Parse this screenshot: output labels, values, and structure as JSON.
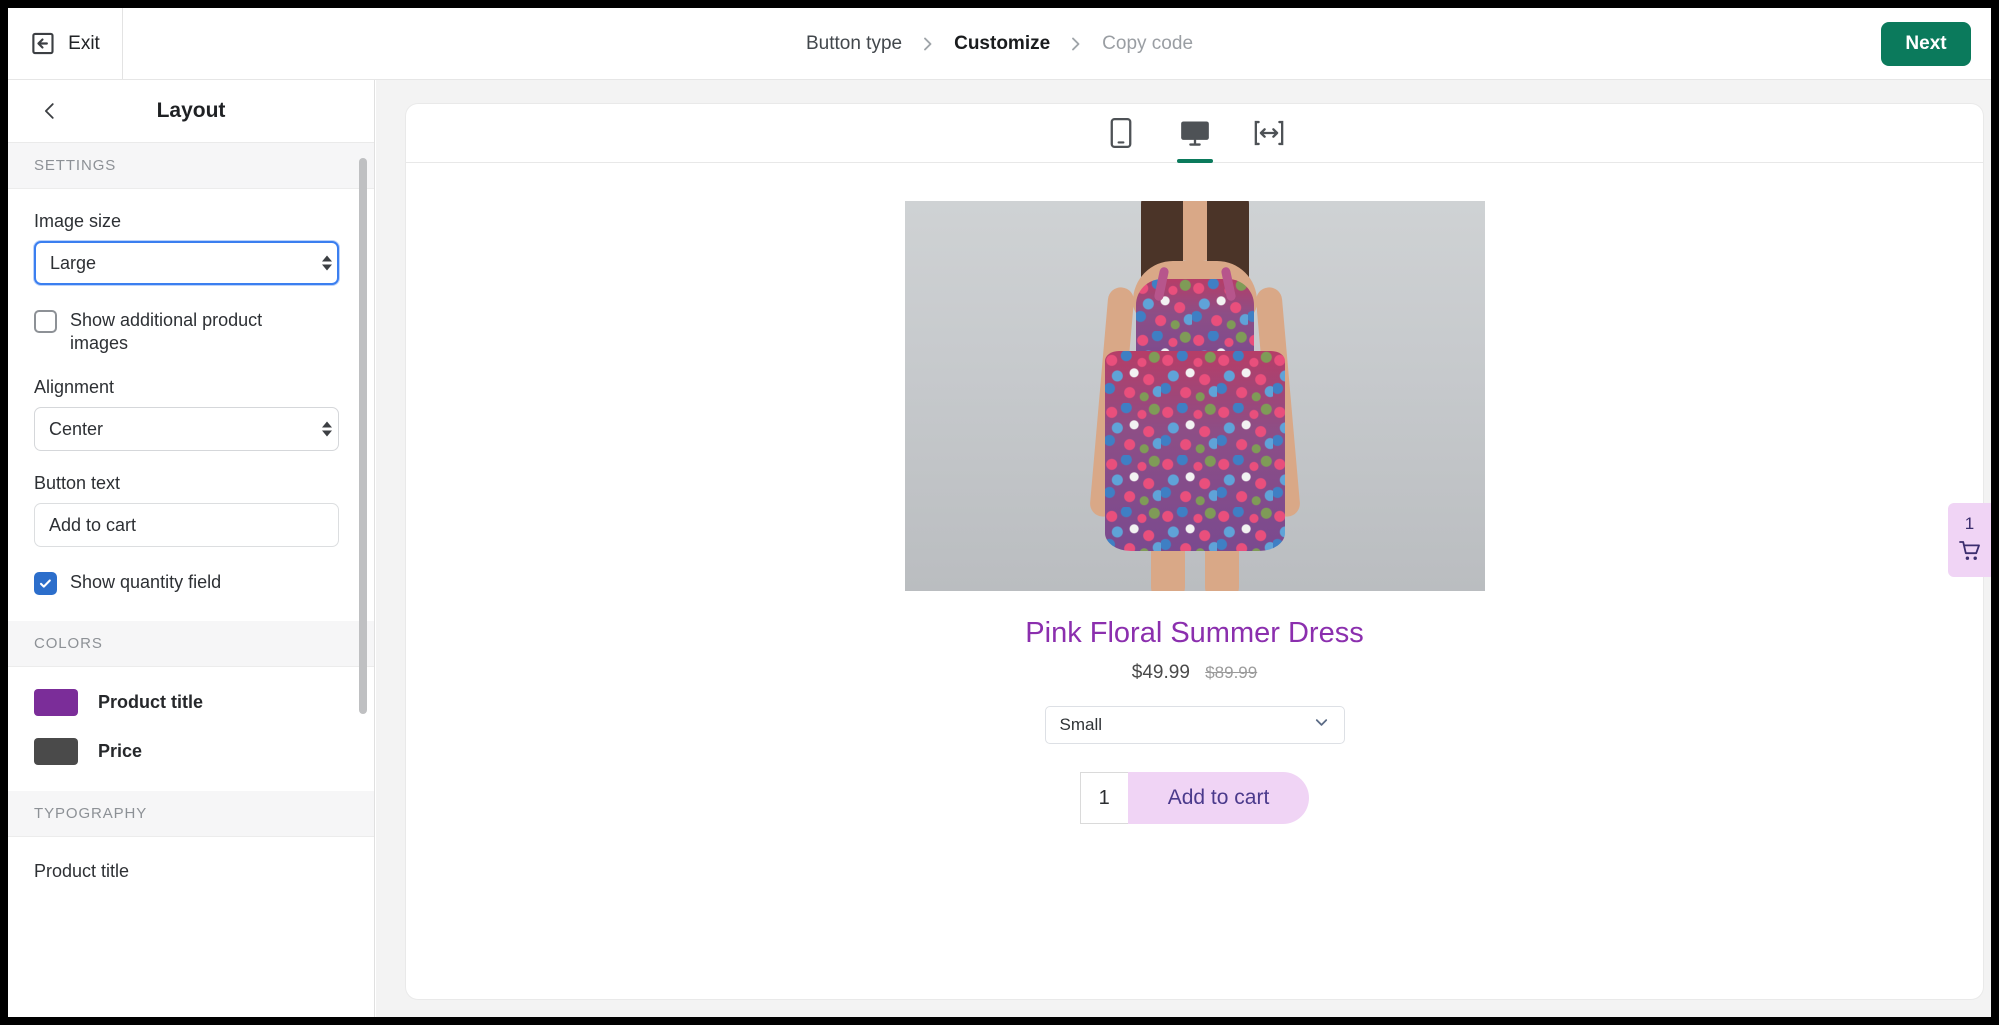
{
  "topbar": {
    "exit_label": "Exit",
    "exit_icon": "exit-arrow-box-icon",
    "breadcrumb": [
      {
        "label": "Button type",
        "state": "done"
      },
      {
        "label": "Customize",
        "state": "active"
      },
      {
        "label": "Copy code",
        "state": "upcoming"
      }
    ],
    "next_label": "Next",
    "next_color": "#0b7a5c"
  },
  "sidebar": {
    "back_icon": "chevron-left-icon",
    "title": "Layout",
    "sections": [
      {
        "key": "settings",
        "heading": "SETTINGS"
      },
      {
        "key": "colors",
        "heading": "COLORS"
      },
      {
        "key": "typography",
        "heading": "TYPOGRAPHY"
      }
    ],
    "settings": {
      "image_size": {
        "label": "Image size",
        "value": "Large"
      },
      "show_additional_images": {
        "label": "Show additional product images",
        "checked": false
      },
      "alignment": {
        "label": "Alignment",
        "value": "Center"
      },
      "button_text": {
        "label": "Button text",
        "value": "Add to cart"
      },
      "show_quantity_field": {
        "label": "Show quantity field",
        "checked": true
      }
    },
    "colors": [
      {
        "label": "Product title",
        "color": "#7b2d99"
      },
      {
        "label": "Price",
        "color": "#4a4a4a"
      }
    ],
    "typography": [
      {
        "label": "Product title"
      }
    ]
  },
  "preview": {
    "devices": [
      {
        "name": "mobile",
        "icon": "mobile-icon",
        "active": false
      },
      {
        "name": "desktop",
        "icon": "desktop-icon",
        "active": true
      },
      {
        "name": "full-width",
        "icon": "full-width-icon",
        "active": false
      }
    ],
    "product": {
      "image_alt": "Pink floral summer dress on model",
      "title": "Pink Floral Summer Dress",
      "price": "$49.99",
      "compare_at_price": "$89.99",
      "variant_value": "Small",
      "variant_icon": "chevron-down-icon",
      "quantity": "1",
      "add_to_cart_label": "Add to cart",
      "title_color": "#8b2fae",
      "button_bg": "#f0d4f5",
      "button_text_color": "#4b3a8c"
    },
    "cart_widget": {
      "count": "1",
      "icon": "shopping-cart-icon"
    }
  }
}
